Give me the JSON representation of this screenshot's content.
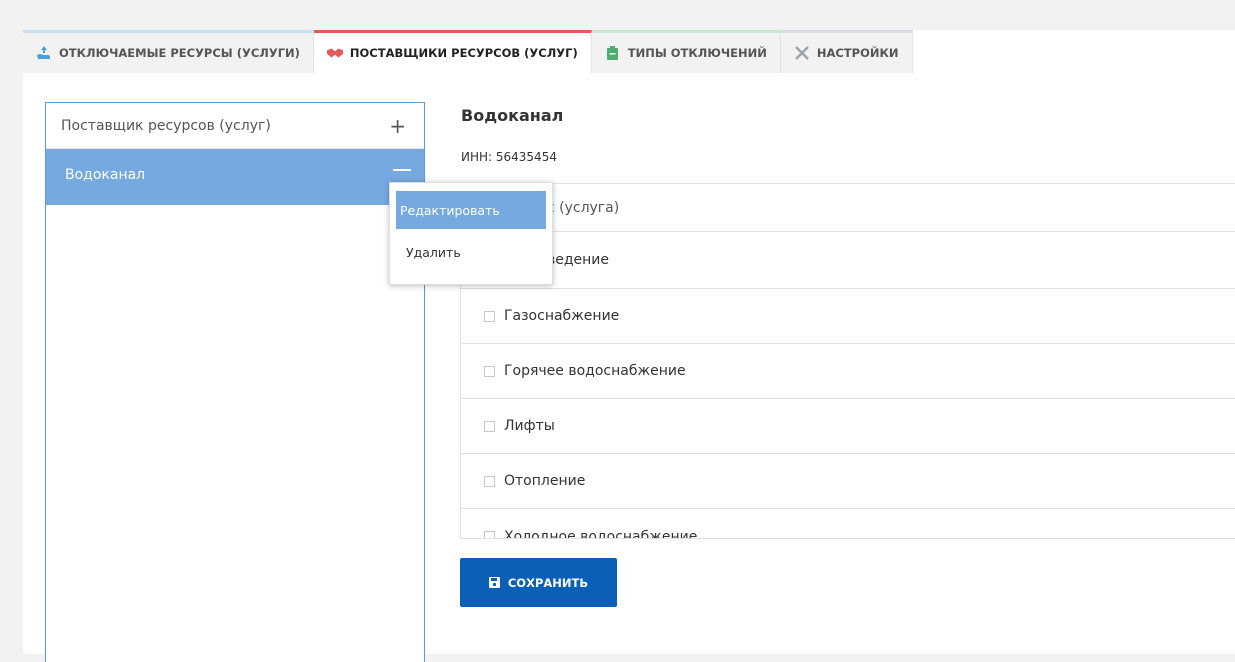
{
  "tabs": [
    {
      "label": "ОТКЛЮЧАЕМЫЕ РЕСУРСЫ (УСЛУГИ)",
      "icon": "resource-icon"
    },
    {
      "label": "ПОСТАВЩИКИ РЕСУРСОВ (УСЛУГ)",
      "icon": "handshake-icon"
    },
    {
      "label": "ТИПЫ ОТКЛЮЧЕНИЙ",
      "icon": "clipboard-icon"
    },
    {
      "label": "НАСТРОЙКИ",
      "icon": "tools-icon"
    }
  ],
  "left_panel": {
    "header_placeholder": "Поставщик ресурсов (услуг)",
    "add_symbol": "+",
    "items": [
      {
        "label": "Водоканал"
      }
    ]
  },
  "context_menu": {
    "edit": "Редактировать",
    "delete": "Удалить"
  },
  "details": {
    "title": "Водоканал",
    "inn": "ИНН: 56435454",
    "list_header": "ый ресурс (услуга)",
    "resources": [
      {
        "label": "ведение"
      },
      {
        "label": "Газоснабжение"
      },
      {
        "label": "Горячее водоснабжение"
      },
      {
        "label": "Лифты"
      },
      {
        "label": "Отопление"
      },
      {
        "label": "Холодное водоснабжение"
      }
    ]
  },
  "save_label": "СОХРАНИТЬ",
  "colors": {
    "accent": "#76a9e0",
    "button": "#0b5fb6",
    "active_tab_border": "#e35a5a"
  }
}
